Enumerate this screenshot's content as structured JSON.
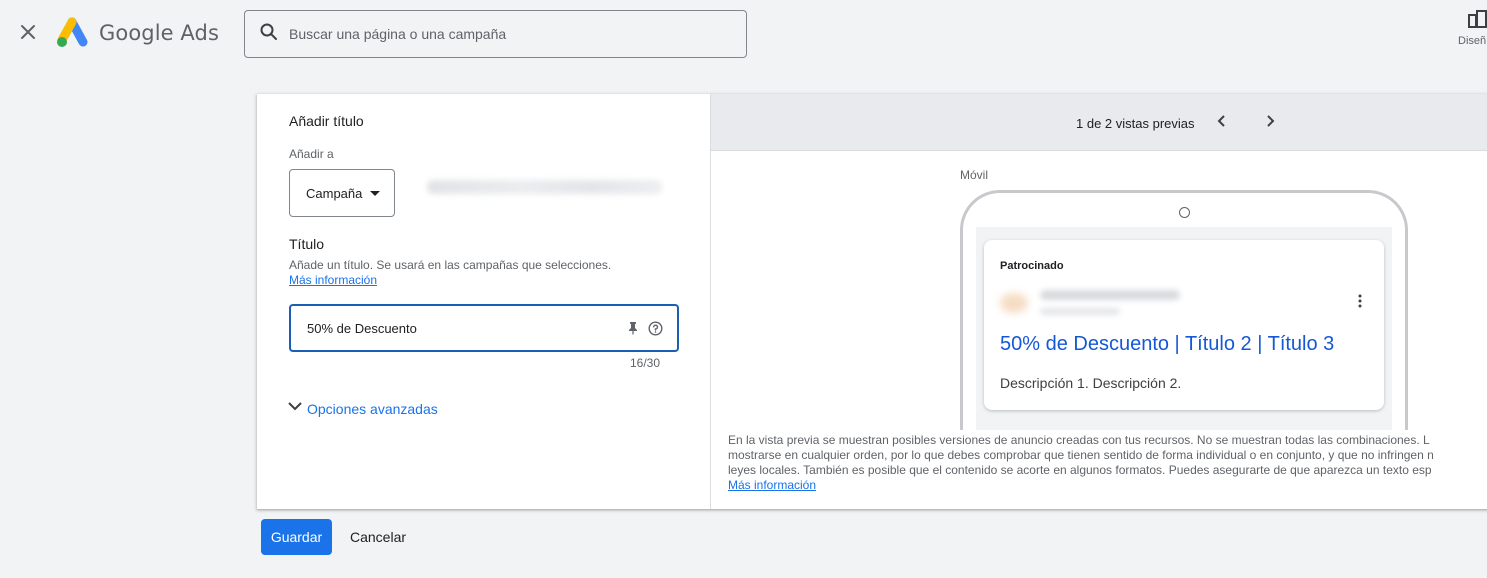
{
  "header": {
    "brand": "Google Ads",
    "search_placeholder": "Buscar una página o una campaña",
    "design_label": "Diseñ"
  },
  "form": {
    "heading": "Añadir título",
    "add_to_label": "Añadir a",
    "campaign_select_value": "Campaña",
    "title_label": "Título",
    "title_help": "Añade un título. Se usará en las campañas que selecciones.",
    "more_info_link": "Más información",
    "title_value": "50% de Descuento",
    "char_counter": "16/30",
    "advanced_options": "Opciones avanzadas"
  },
  "preview": {
    "count_label": "1 de 2 vistas previas",
    "device_label": "Móvil",
    "ad": {
      "sponsored": "Patrocinado",
      "headline": "50% de Descuento | Título 2 | Título 3",
      "description": "Descripción 1. Descripción 2."
    },
    "disclaimer_lines": [
      "En la vista previa se muestran posibles versiones de anuncio creadas con tus recursos. No se muestran todas las combinaciones. L",
      "mostrarse en cualquier orden, por lo que debes comprobar que tienen sentido de forma individual o en conjunto, y que no infringen n",
      "leyes locales. También es posible que el contenido se acorte en algunos formatos. Puedes asegurarte de que aparezca un texto esp"
    ],
    "disclaimer_link": "Más información"
  },
  "actions": {
    "save": "Guardar",
    "cancel": "Cancelar"
  },
  "colors": {
    "accent": "#1a73e8",
    "headline_link": "#1558d6",
    "page_bg": "#f1f3f4"
  },
  "icons": {
    "close": "close-icon",
    "search": "search-icon",
    "design": "design-icon",
    "pin": "pin-icon",
    "help": "help-circle-icon",
    "chevron_left": "chevron-left-icon",
    "chevron_right": "chevron-right-icon",
    "chevron_down": "chevron-down-icon",
    "more": "more-vert-icon"
  }
}
